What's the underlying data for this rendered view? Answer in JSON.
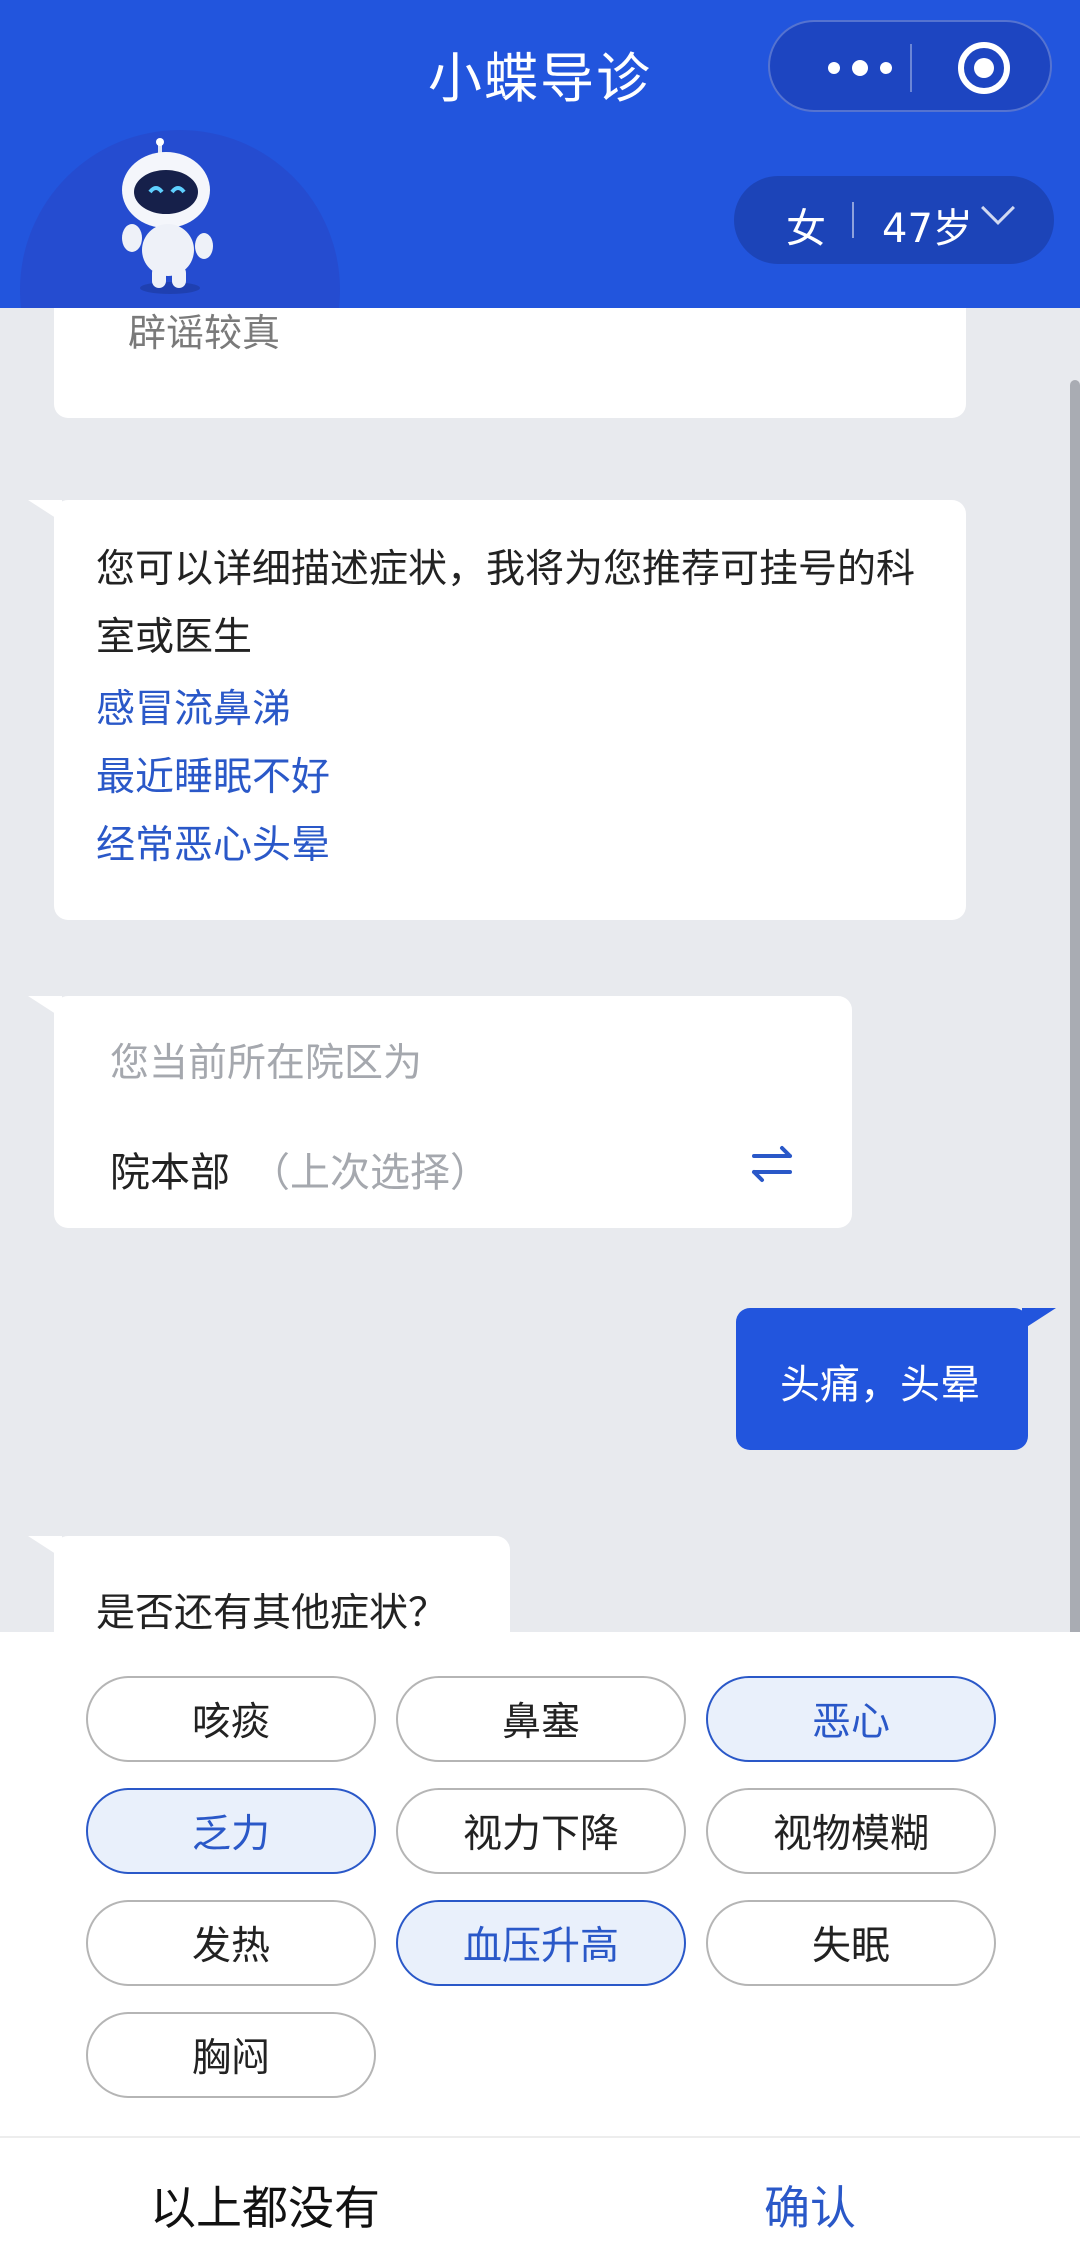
{
  "header": {
    "title": "小蝶导诊",
    "profile": {
      "gender": "女",
      "age": "47岁"
    }
  },
  "icons": {
    "more": "more-dots-icon",
    "close": "target-circle-icon",
    "swap": "swap-arrows-icon",
    "chevron": "chevron-down-icon",
    "avatar": "robot-mascot-icon"
  },
  "colors": {
    "primary": "#2255dd",
    "link": "#2a58c8",
    "chip_selected_bg": "#e9f0fb"
  },
  "chat": {
    "messages": [
      {
        "from": "bot",
        "text": "辟谣较真"
      },
      {
        "from": "bot",
        "text": "您可以详细描述症状，我将为您推荐可挂号的科室或医生",
        "suggestions": [
          "感冒流鼻涕",
          "最近睡眠不好",
          "经常恶心头晕"
        ]
      },
      {
        "from": "bot",
        "caption": "您当前所在院区为",
        "campus": "院本部",
        "note": "（上次选择）"
      },
      {
        "from": "user",
        "text": "头痛，头晕"
      },
      {
        "from": "bot",
        "text": "是否还有其他症状？"
      }
    ]
  },
  "symptoms": [
    {
      "label": "咳痰",
      "selected": false
    },
    {
      "label": "鼻塞",
      "selected": false
    },
    {
      "label": "恶心",
      "selected": true
    },
    {
      "label": "乏力",
      "selected": true
    },
    {
      "label": "视力下降",
      "selected": false
    },
    {
      "label": "视物模糊",
      "selected": false
    },
    {
      "label": "发热",
      "selected": false
    },
    {
      "label": "血压升高",
      "selected": true
    },
    {
      "label": "失眠",
      "selected": false
    },
    {
      "label": "胸闷",
      "selected": false
    }
  ],
  "footer": {
    "none_label": "以上都没有",
    "confirm_label": "确认"
  }
}
